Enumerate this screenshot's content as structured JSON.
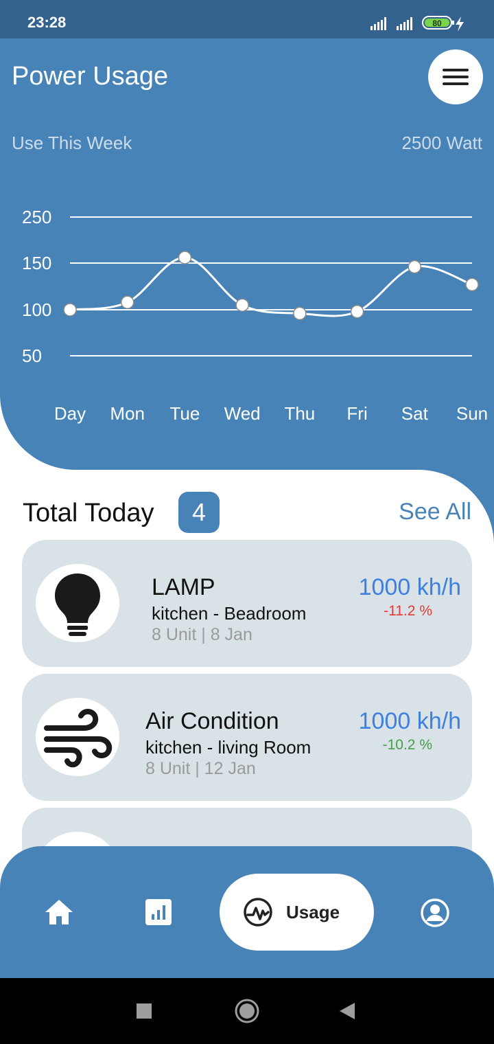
{
  "status_bar": {
    "time": "23:28",
    "battery": "80"
  },
  "header": {
    "title": "Power Usage",
    "subtitle": "Use This Week",
    "total": "2500 Watt"
  },
  "chart_data": {
    "type": "line",
    "categories": [
      "Day",
      "Mon",
      "Tue",
      "Wed",
      "Thu",
      "Fri",
      "Sat",
      "Sun"
    ],
    "series": [
      {
        "values": [
          100,
          108,
          162,
          105,
          96,
          98,
          146,
          127
        ]
      }
    ],
    "y_ticks": [
      "250",
      "150",
      "100",
      "50"
    ],
    "grid": true,
    "smooth": true
  },
  "summary": {
    "title": "Total Today",
    "count": "4",
    "see_all": "See All"
  },
  "devices": [
    {
      "name": "LAMP",
      "location": "kitchen - Beadroom",
      "meta": "8 Unit | 8 Jan",
      "power": "1000 kh/h",
      "change": "-11.2 %",
      "change_color": "#e53935",
      "icon": "lightbulb-icon"
    },
    {
      "name": "Air Condition",
      "location": "kitchen - living Room",
      "meta": "8 Unit | 12 Jan",
      "power": "1000 kh/h",
      "change": "-10.2 %",
      "change_color": "#43a047",
      "icon": "wind-icon"
    }
  ],
  "nav": {
    "items": [
      {
        "name": "home",
        "icon": "home-icon"
      },
      {
        "name": "stats",
        "icon": "bar-chart-icon"
      },
      {
        "name": "usage",
        "icon": "activity-icon",
        "label": "Usage",
        "active": true
      },
      {
        "name": "profile",
        "icon": "account-icon"
      }
    ]
  },
  "colors": {
    "primary": "#4783b7",
    "status_bar": "#34628f",
    "card": "#d9e3e7",
    "power_text": "#3f7fe0"
  }
}
